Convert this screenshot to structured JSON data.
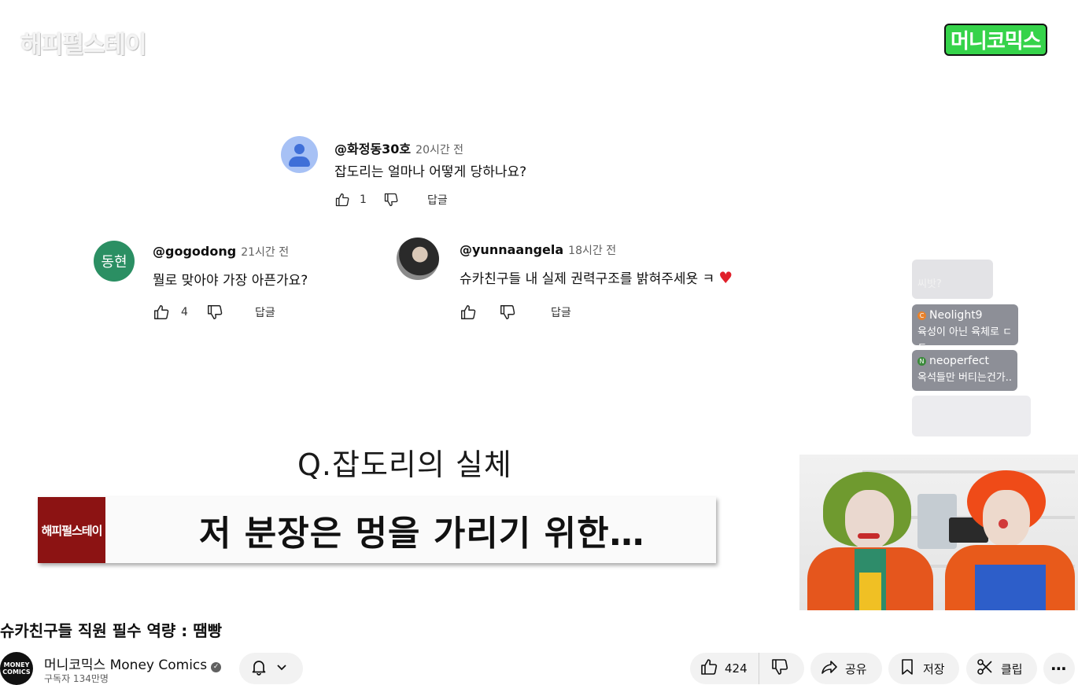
{
  "video": {
    "top_left_logo": "해피펄스테이",
    "top_right_logo": "머니코믹스",
    "comments": [
      {
        "user": "@화정동30호",
        "time": "20시간 전",
        "text": "잡도리는 얼마나 어떻게 당하나요?",
        "likes": "1",
        "reply": "답글"
      },
      {
        "user": "@gogodong",
        "time": "21시간 전",
        "text": "뭘로 맞아야 가장 아픈가요?",
        "likes": "4",
        "reply": "답글",
        "avatar_text": "동현"
      },
      {
        "user": "@yunnaangela",
        "time": "18시간 전",
        "text": "슈카친구들 내 실제 권력구조를 밝혀주세욧 ㅋ",
        "likes": "",
        "reply": "답글"
      }
    ],
    "chat": [
      {
        "name": "",
        "text": "씨밧?"
      },
      {
        "name": "Neolight9",
        "text": "육성이 아닌 육체로 ㄷㄷ",
        "dot": "C",
        "dot_color": "#e8812a"
      },
      {
        "name": "neoperfect",
        "text": "옥석들만 버티는건가....",
        "dot": "N",
        "dot_color": "#3a8a3a"
      }
    ],
    "question": "Q.잡도리의 실체",
    "caption_logo": "해피펄스테이",
    "caption": "저 분장은 멍을 가리기 위한…"
  },
  "meta": {
    "title": "슈카친구들 직원 필수 역량 : 땜빵",
    "channel_name": "머니코믹스 Money Comics",
    "channel_avatar_text": "MONEY COMICS",
    "subscribers": "구독자 134만명",
    "like_count": "424",
    "share_label": "공유",
    "save_label": "저장",
    "clip_label": "클립"
  },
  "colors": {
    "caption_logo_bg": "#8c1313",
    "heart": "#e0202a",
    "brand_green": "#35d34a"
  }
}
